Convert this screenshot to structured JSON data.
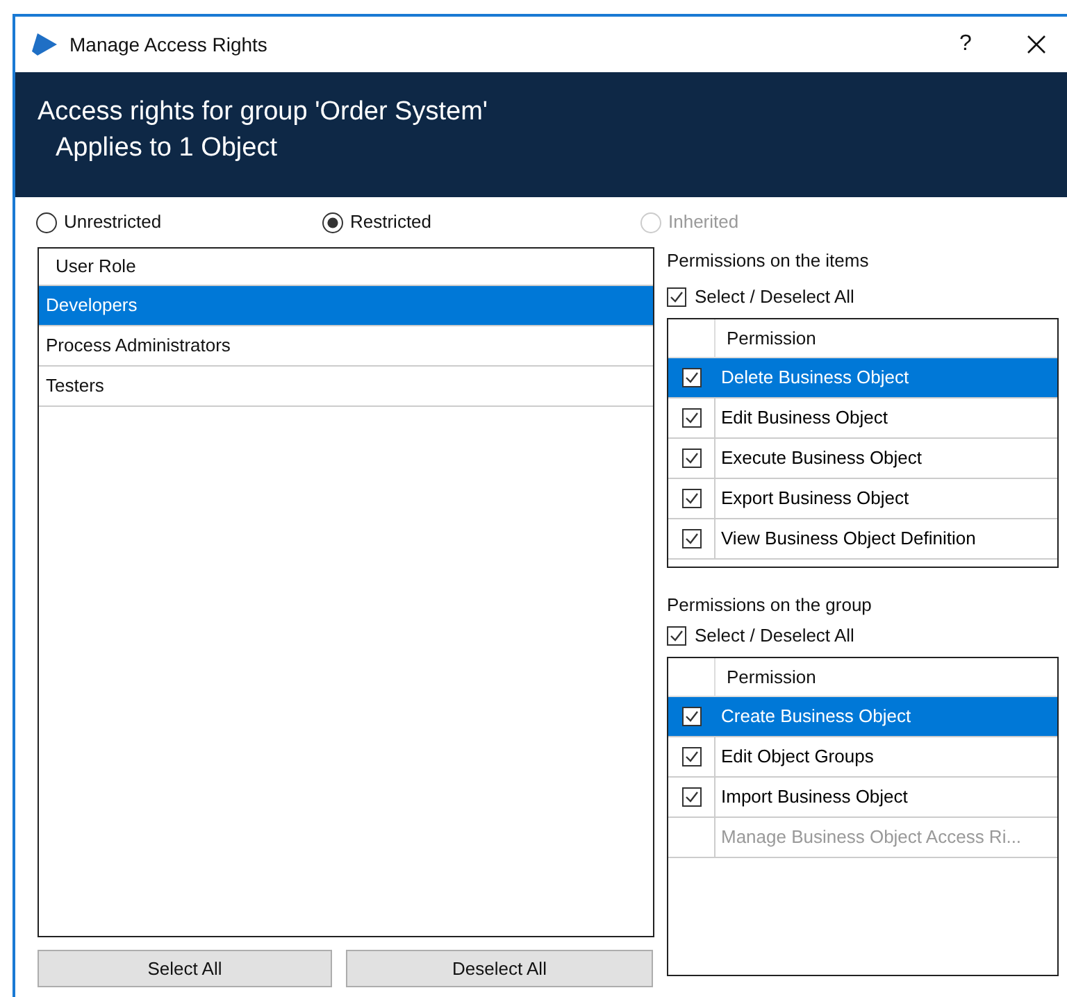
{
  "window": {
    "title": "Manage Access Rights",
    "help": "?"
  },
  "header": {
    "title": "Access rights for group 'Order System'",
    "subtitle": "Applies to 1 Object"
  },
  "access_modes": [
    {
      "label": "Unrestricted",
      "selected": false,
      "disabled": false
    },
    {
      "label": "Restricted",
      "selected": true,
      "disabled": false
    },
    {
      "label": "Inherited",
      "selected": false,
      "disabled": true
    }
  ],
  "roles": {
    "column": "User Role",
    "rows": [
      {
        "name": "Developers",
        "selected": true
      },
      {
        "name": "Process Administrators",
        "selected": false
      },
      {
        "name": "Testers",
        "selected": false
      }
    ]
  },
  "role_buttons": [
    "Select All",
    "Deselect All"
  ],
  "permission_sections": [
    {
      "title": "Permissions on the items",
      "select_all": {
        "label": "Select / Deselect All",
        "checked": true
      },
      "column": "Permission",
      "rows": [
        {
          "name": "Delete Business Object",
          "checked": true,
          "selected": true,
          "disabled": false
        },
        {
          "name": "Edit Business Object",
          "checked": true,
          "selected": false,
          "disabled": false
        },
        {
          "name": "Execute Business Object",
          "checked": true,
          "selected": false,
          "disabled": false
        },
        {
          "name": "Export Business Object",
          "checked": true,
          "selected": false,
          "disabled": false
        },
        {
          "name": "View Business Object Definition",
          "checked": true,
          "selected": false,
          "disabled": false
        }
      ]
    },
    {
      "title": "Permissions on the group",
      "select_all": {
        "label": "Select / Deselect All",
        "checked": true
      },
      "column": "Permission",
      "rows": [
        {
          "name": "Create Business Object",
          "checked": true,
          "selected": true,
          "disabled": false
        },
        {
          "name": "Edit Object Groups",
          "checked": true,
          "selected": false,
          "disabled": false
        },
        {
          "name": "Import Business Object",
          "checked": true,
          "selected": false,
          "disabled": false
        },
        {
          "name": "Manage Business Object Access Ri...",
          "checked": false,
          "selected": false,
          "disabled": true
        }
      ]
    }
  ]
}
